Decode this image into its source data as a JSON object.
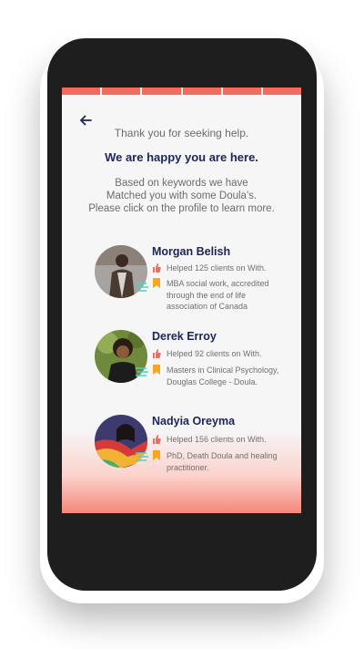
{
  "colors": {
    "accent": "#f46b5d",
    "heading": "#1b2559",
    "body_text": "#707070",
    "bookmark": "#f5a623",
    "badge_lines": "#4fd1c5"
  },
  "progress": {
    "segments": 6,
    "completed": 6
  },
  "nav": {
    "back_icon": "arrow-left-icon"
  },
  "intro": {
    "greeting": "Thank you for seeking help.",
    "headline": "We are happy you are here.",
    "message": "Based on keywords we have\nMatched you with some Doula's.\nPlease click on the profile to learn more."
  },
  "doulas": [
    {
      "name": "Morgan Belish",
      "helped": "Helped 125 clients on With.",
      "credentials": "MBA social work, accredited through the end of life association of Canada"
    },
    {
      "name": "Derek Erroy",
      "helped": "Helped 92 clients on With.",
      "credentials": "Masters in Clinical Psychology, Douglas College - Doula."
    },
    {
      "name": "Nadyia Oreyma",
      "helped": "Helped 156 clients on With.",
      "credentials": "PhD, Death Doula and healing practitioner."
    }
  ],
  "icons": {
    "helped": "thumbs-up-icon",
    "credentials": "bookmark-icon",
    "badge": "verified-lines-icon"
  }
}
